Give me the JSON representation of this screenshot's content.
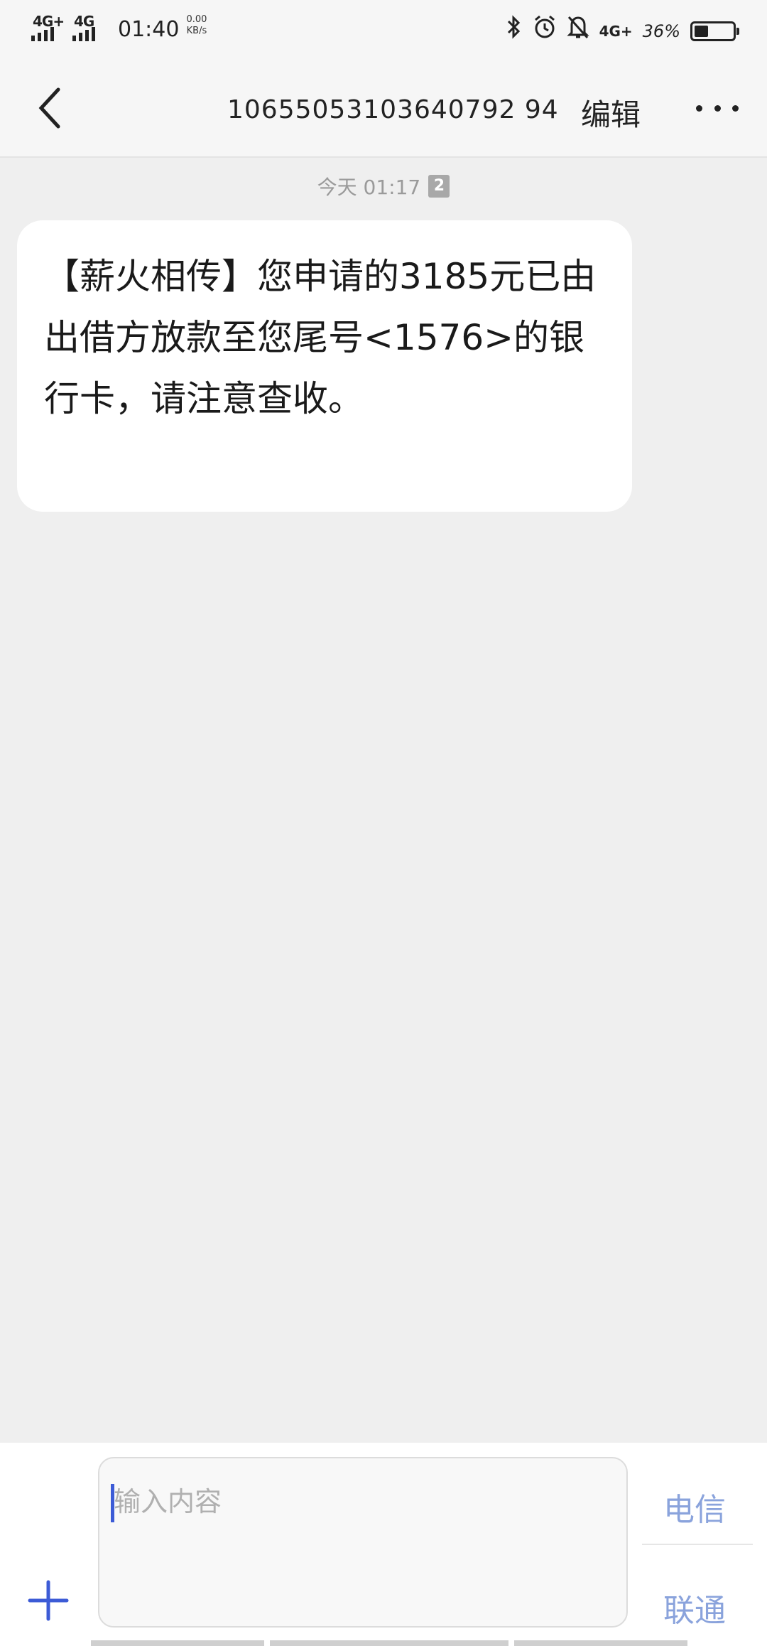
{
  "status_bar": {
    "signal_1_label": "4G+",
    "signal_2_label": "4G",
    "time": "01:40",
    "speed_value": "0.00",
    "speed_unit": "KB/s",
    "signal_3_label": "4G+",
    "battery_percent": "36%",
    "battery_level": 0.36
  },
  "header": {
    "title": "10655053103640792 94",
    "edit_label": "编辑"
  },
  "conversation": {
    "date_label": "今天 01:17",
    "sim_badge": "2",
    "message_text": "【薪火相传】您申请的3185元已由出借方放款至您尾号<1576>的银行卡，请注意查收。"
  },
  "composer": {
    "placeholder": "输入内容",
    "send_telecom_label": "电信",
    "send_unicom_label": "联通"
  },
  "colors": {
    "accent": "#3c5bd6",
    "send_text": "#8aa3dc",
    "background": "#efefef"
  }
}
